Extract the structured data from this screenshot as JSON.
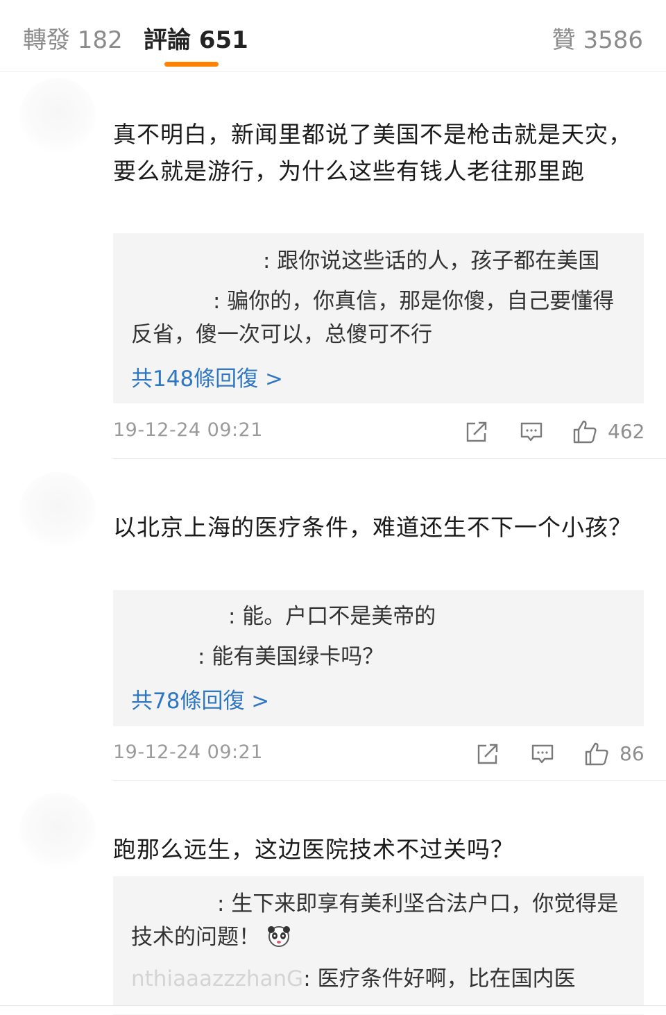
{
  "tabs": {
    "repost": "轉發 182",
    "comments": "評論 651",
    "likes": "贊 3586"
  },
  "comments": [
    {
      "text": "真不明白，新闻里都说了美国不是枪击就是天灾，要么就是游行，为什么这些有钱人老往那里跑",
      "replies": [
        {
          "name": "",
          "text": ": 跟你说这些话的人，孩子都在美国"
        },
        {
          "name": "",
          "text": ": 骗你的，你真信，那是你傻，自己要懂得反省，傻一次可以，总傻可不行"
        }
      ],
      "more": "共148條回復 >",
      "time": "19-12-24 09:21",
      "likes": "462"
    },
    {
      "text": "以北京上海的医疗条件，难道还生不下一个小孩？",
      "replies": [
        {
          "name": "",
          "text": ": 能。户口不是美帝的"
        },
        {
          "name": "",
          "text": ": 能有美国绿卡吗？"
        }
      ],
      "more": "共78條回復 >",
      "time": "19-12-24 09:21",
      "likes": "86"
    },
    {
      "text": "跑那么远生，这边医院技术不过关吗？",
      "replies": [
        {
          "name": "",
          "text": ": 生下来即享有美利坚合法户口，你觉得是技术的问题！"
        },
        {
          "name": "nthiaaazzzhanG",
          "text": ": 医疗条件好啊，比在国内医"
        }
      ]
    }
  ],
  "icons": {
    "share": "share-icon",
    "comment": "comment-icon",
    "like": "thumbs-up-icon",
    "emoji": "panda-emoji-icon"
  },
  "colors": {
    "accent": "#ff8200",
    "link": "#2f77c3"
  }
}
